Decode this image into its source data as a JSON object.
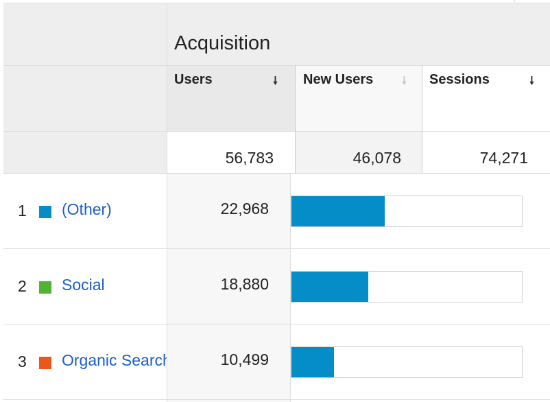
{
  "group": {
    "title": "Acquisition"
  },
  "columns": [
    {
      "label": "Users",
      "sort_icon": "sort-desc-icon",
      "sort_glyph": "🠗",
      "sort_color": "#333333"
    },
    {
      "label": "New Users",
      "sort_icon": "sort-desc-icon",
      "sort_glyph": "🠗",
      "sort_color": "#c8c8c8"
    },
    {
      "label": "Sessions",
      "sort_icon": "sort-desc-icon",
      "sort_glyph": "🠗",
      "sort_color": "#333333"
    }
  ],
  "totals": {
    "users": "56,783",
    "new_users": "46,078",
    "sessions": "74,271"
  },
  "bar_color": "#058dc7",
  "rows": [
    {
      "num": "1",
      "label": "(Other)",
      "color": "#058dc7",
      "users": "22,968",
      "share": 0.404
    },
    {
      "num": "2",
      "label": "Social",
      "color": "#50b432",
      "users": "18,880",
      "share": 0.332
    },
    {
      "num": "3",
      "label": "Organic Search",
      "color": "#ed561b",
      "users": "10,499",
      "share": 0.185
    }
  ]
}
